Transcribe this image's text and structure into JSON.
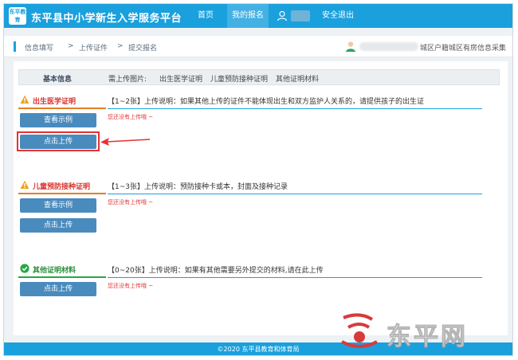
{
  "header": {
    "logo_text": "东平教育",
    "title": "东平县中小学新生入学服务平台",
    "nav": {
      "home": "首页",
      "mine": "我的报名",
      "logout": "安全退出"
    }
  },
  "breadcrumb": {
    "step1": "信息填写",
    "step2": "上传证件",
    "step3": "提交报名",
    "separator": ">"
  },
  "user": {
    "school_suffix": "城区户籍城区有房信息采集"
  },
  "basic_info": {
    "title": "基本信息",
    "need_label": "需上传图片:",
    "items": [
      "出生医学证明",
      "儿童预防接种证明",
      "其他证明材料"
    ]
  },
  "sections": [
    {
      "title": "出生医学证明",
      "desc": "【1~2张】上传说明：如果其他上传的证件不能体现出生和双方监护人关系的，请提供孩子的出生证",
      "empty": "您还没有上传哦 ~",
      "btn_example": "查看示例",
      "btn_upload": "点击上传"
    },
    {
      "title": "儿童预防接种证明",
      "desc": "【1~3张】上传说明：预防接种卡或本，封面及接种记录",
      "empty": "您还没有上传哦 ~",
      "btn_example": "查看示例",
      "btn_upload": "点击上传"
    },
    {
      "title": "其他证明材料",
      "desc": "【0~20张】上传说明：如果有其他需要另外提交的材料,请在此上传",
      "empty": "您还没有上传哦 ~",
      "btn_upload": "点击上传"
    }
  ],
  "footer": {
    "text": "©2020 东平县教育和体育局"
  },
  "watermark": {
    "text": "东平网"
  },
  "colors": {
    "primary": "#1aa0dd",
    "button": "#4a8bbe",
    "warn": "#e67e22",
    "ok": "#27a745",
    "error": "#e03a3a"
  }
}
